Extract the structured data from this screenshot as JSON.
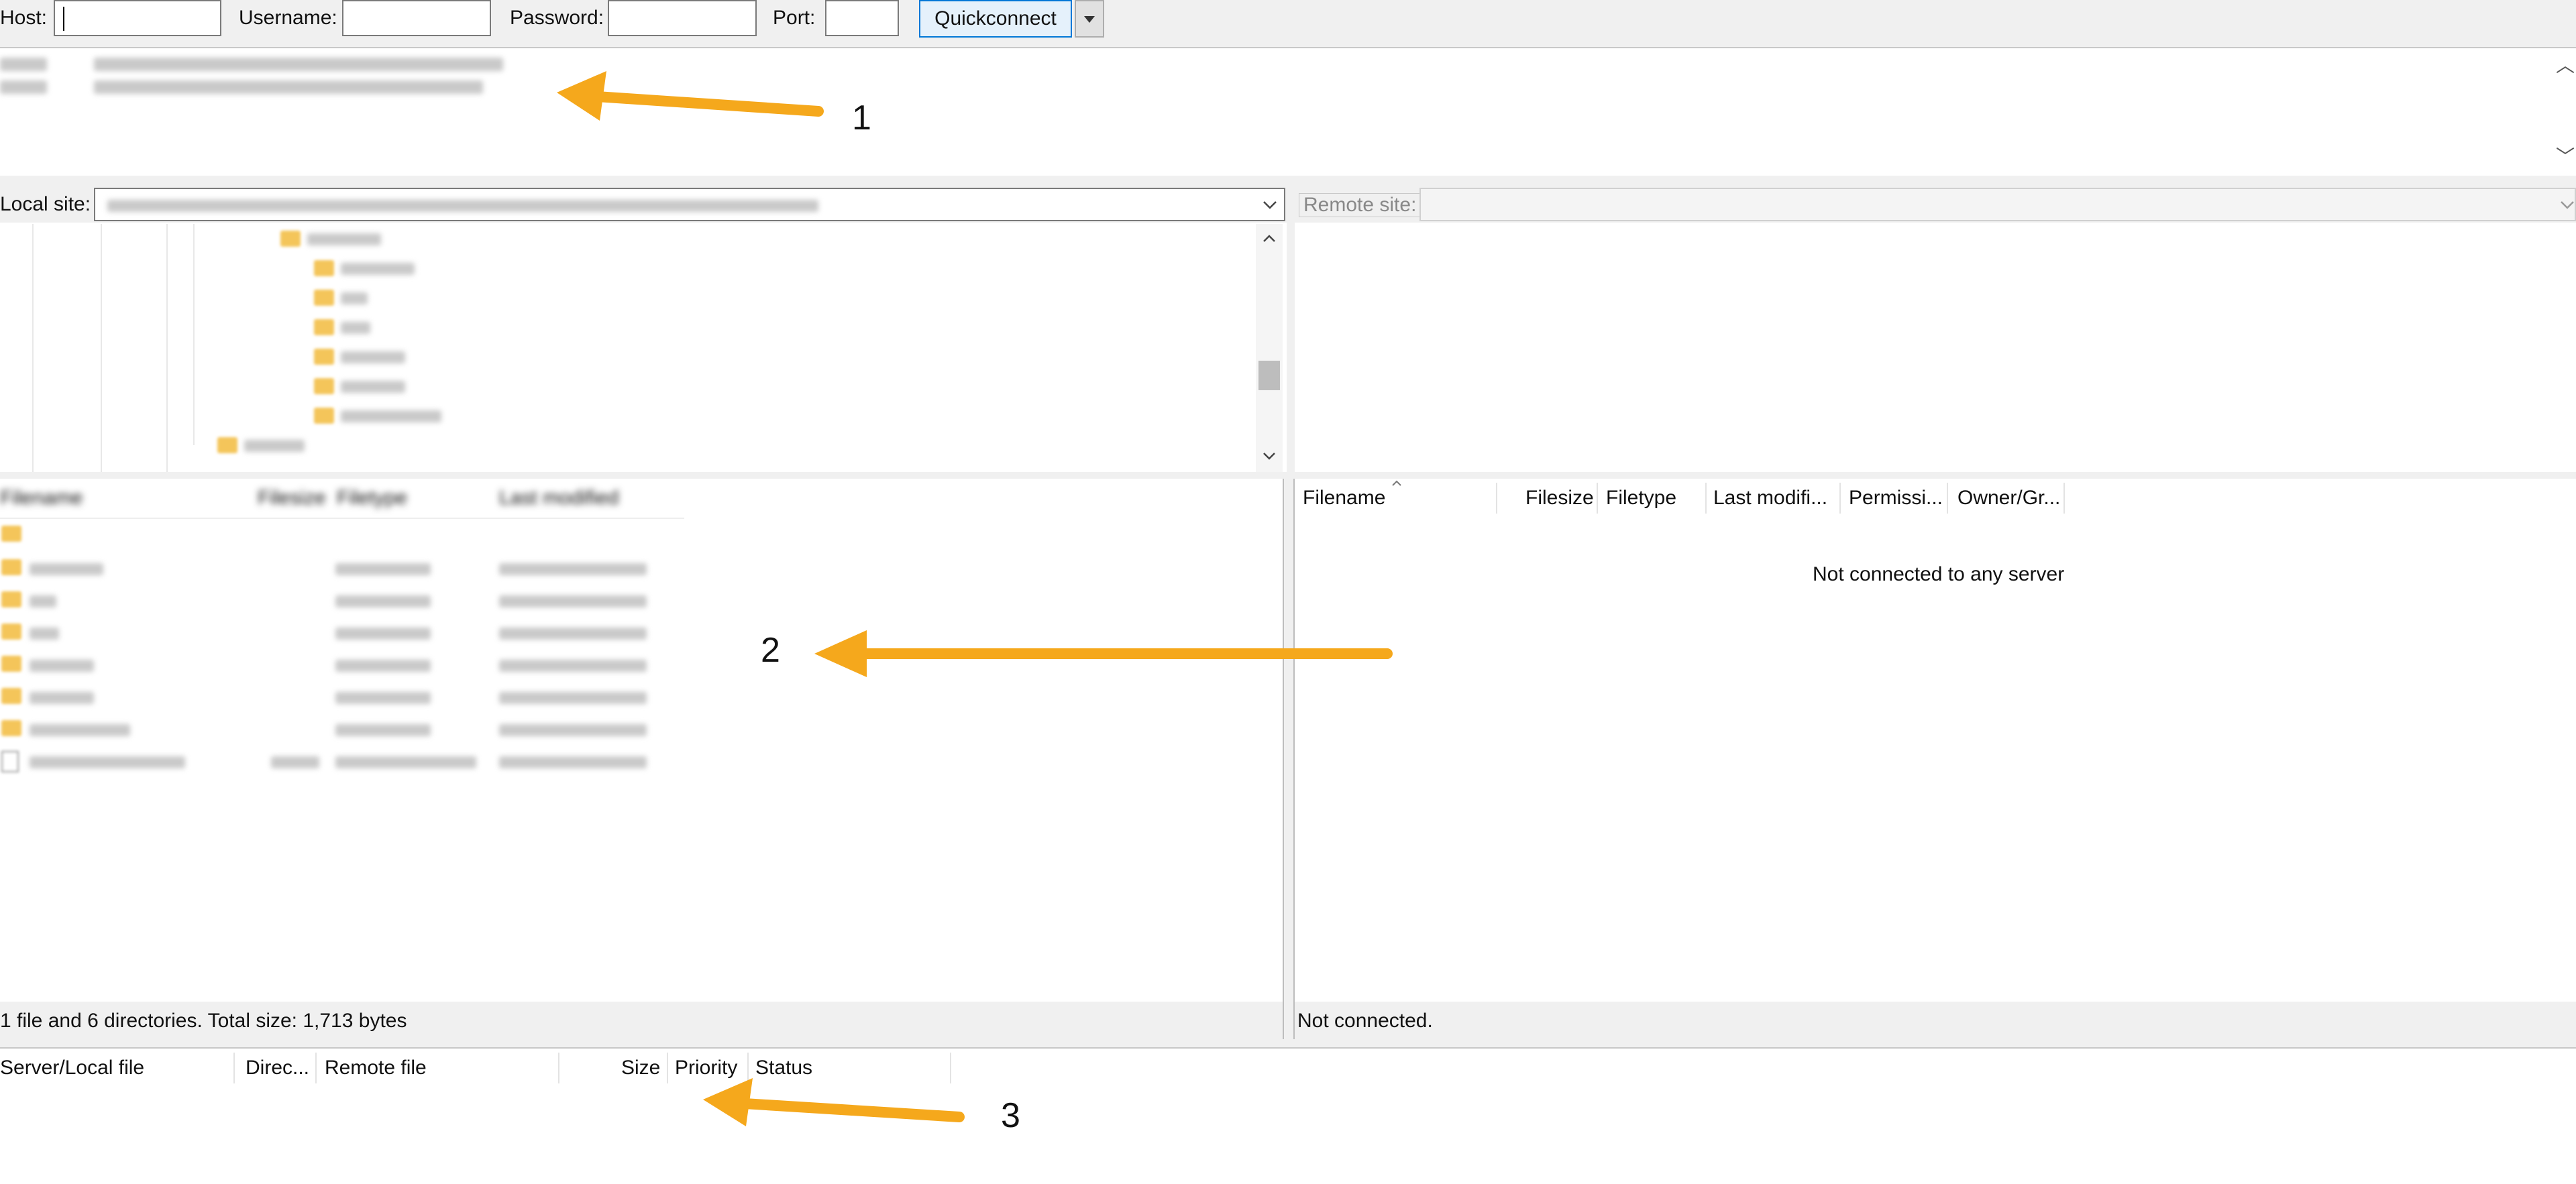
{
  "quickconnect": {
    "host_label": "Host:",
    "username_label": "Username:",
    "password_label": "Password:",
    "port_label": "Port:",
    "button_label": "Quickconnect",
    "host_value": "",
    "username_value": "",
    "password_value": "",
    "port_value": ""
  },
  "local": {
    "site_label": "Local site:",
    "file_headers": [
      "Filename",
      "Filesize",
      "Filetype",
      "Last modified"
    ],
    "status": "1 file and 6 directories. Total size: 1,713 bytes"
  },
  "remote": {
    "site_label": "Remote site:",
    "file_headers": [
      "Filename",
      "Filesize",
      "Filetype",
      "Last modifi...",
      "Permissi...",
      "Owner/Gr..."
    ],
    "empty_message": "Not connected to any server",
    "status": "Not connected."
  },
  "queue": {
    "headers": [
      "Server/Local file",
      "Direc...",
      "Remote file",
      "Size",
      "Priority",
      "Status"
    ]
  },
  "annotations": {
    "one": "1",
    "two": "2",
    "three": "3"
  },
  "colors": {
    "arrow": "#f5a81c",
    "accent": "#0078d7",
    "panel_bg": "#f0f0f0"
  }
}
